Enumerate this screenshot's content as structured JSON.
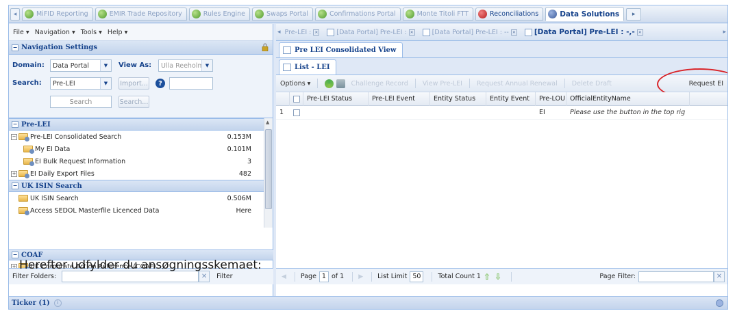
{
  "top_tabs": [
    {
      "label": "MiFID Reporting",
      "style": "faded",
      "icon": "globe-green-icon"
    },
    {
      "label": "EMIR Trade Repository",
      "style": "faded",
      "icon": "globe-green-icon"
    },
    {
      "label": "Rules Engine",
      "style": "faded",
      "icon": "globe-green-icon"
    },
    {
      "label": "Swaps Portal",
      "style": "faded",
      "icon": "globe-green-icon"
    },
    {
      "label": "Confirmations Portal",
      "style": "faded",
      "icon": "globe-green-icon"
    },
    {
      "label": "Monte Titoli FTT",
      "style": "faded",
      "icon": "globe-green-icon"
    },
    {
      "label": "Reconciliations",
      "style": "strong",
      "icon": "globe-red-icon"
    },
    {
      "label": "Data Solutions",
      "style": "active",
      "icon": "globe-blue-icon"
    }
  ],
  "menu": {
    "file": "File ▾",
    "navigation": "Navigation ▾",
    "tools": "Tools ▾",
    "help": "Help ▾"
  },
  "nav_settings": {
    "title": "Navigation Settings",
    "domain_label": "Domain:",
    "domain_value": "Data Portal",
    "view_as_label": "View As:",
    "view_as_value": "Ulla Reeholm",
    "search_label": "Search:",
    "search_value": "Pre-LEI",
    "import_label": "Import...",
    "search_placeholder": "Search",
    "search_button": "Search..."
  },
  "tree": {
    "section_pre_lei": "Pre-LEI",
    "items_pre_lei": [
      {
        "label": "Pre-LEI Consolidated Search",
        "value": "0.153M",
        "expander": "⊟",
        "indent": 0
      },
      {
        "label": "My EI Data",
        "value": "0.101M",
        "expander": "",
        "indent": 1
      },
      {
        "label": "EI Bulk Request Information",
        "value": "3",
        "expander": "",
        "indent": 1
      },
      {
        "label": "EI Daily Export Files",
        "value": "482",
        "expander": "⊞",
        "indent": 0
      }
    ],
    "section_uk_isin": "UK ISIN Search",
    "items_uk_isin": [
      {
        "label": "UK ISIN Search",
        "value": "0.506M",
        "expander": "",
        "indent": 0
      },
      {
        "label": "Access SEDOL Masterfile Licenced Data",
        "value": "Here",
        "expander": "",
        "indent": 0
      }
    ],
    "section_coaf": "COAF",
    "items_coaf": [
      {
        "label": "UK Corporate Action Reference (COAF)",
        "value": "",
        "expander": "⊞",
        "indent": 0
      }
    ]
  },
  "filter": {
    "label": "Filter Folders:",
    "button": "Filter"
  },
  "right_tabs": [
    {
      "label": "Pre-LEI :",
      "active": false
    },
    {
      "label": "[Data Portal] Pre-LEI :",
      "active": false
    },
    {
      "label": "[Data Portal] Pre-LEI : --",
      "active": false
    },
    {
      "label": "[Data Portal] Pre-LEI : -,-",
      "active": true
    }
  ],
  "view_tab": "Pre LEI Consolidated View",
  "list_tab": "List - LEI",
  "toolbar": {
    "options": "Options ▾",
    "challenge": "Challenge Record",
    "view_pre_lei": "View Pre-LEI",
    "request_annual": "Request Annual Renewal",
    "delete_draft": "Delete Draft",
    "request_ei": "Request EI"
  },
  "grid": {
    "columns": [
      "Pre-LEI Status",
      "Pre-LEI Event",
      "Entity Status",
      "Entity Event",
      "Pre-LOU",
      "OfficialEntityName"
    ],
    "rows": [
      {
        "num": "1",
        "cells": [
          "",
          "",
          "",
          "",
          "EI",
          "Please use the button in the top rig"
        ]
      }
    ]
  },
  "pagination": {
    "page_label": "Page",
    "page_value": "1",
    "of_label": "of 1",
    "list_limit_label": "List Limit",
    "list_limit_value": "50",
    "total_count": "Total Count 1",
    "page_filter_label": "Page Filter:"
  },
  "ticker": {
    "label": "Ticker (1)"
  },
  "overlay_caption": "Herefter udfylder du ansøgningsskemaet:"
}
